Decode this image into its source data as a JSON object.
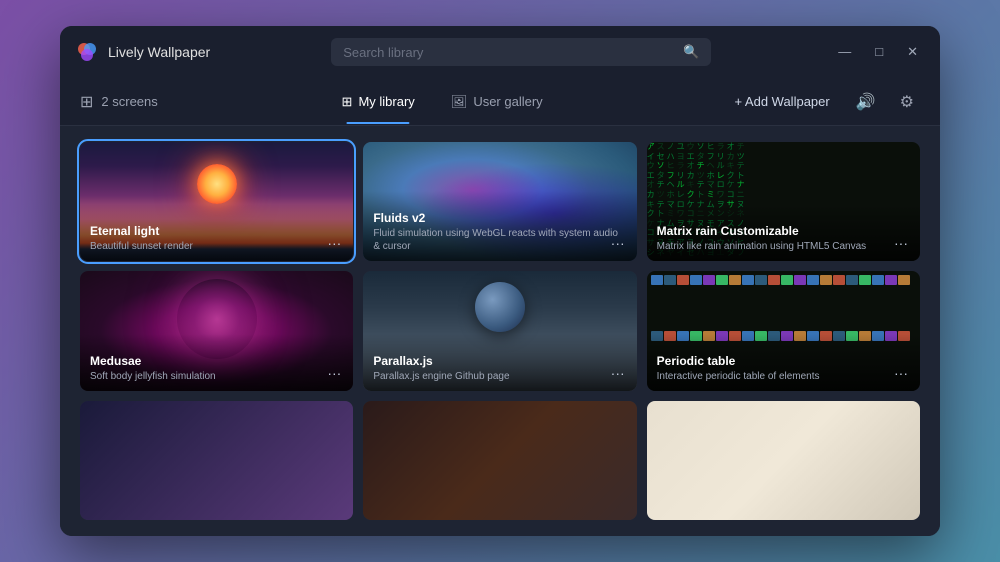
{
  "app": {
    "title": "Lively Wallpaper",
    "search_placeholder": "Search library"
  },
  "window_controls": {
    "minimize": "—",
    "maximize": "□",
    "close": "✕"
  },
  "toolbar": {
    "screens_count": "2 screens",
    "my_library_label": "My library",
    "user_gallery_label": "User gallery",
    "add_wallpaper_label": "+ Add Wallpaper"
  },
  "wallpapers": [
    {
      "id": "eternal-light",
      "title": "Eternal light",
      "desc": "Beautiful sunset render",
      "selected": true
    },
    {
      "id": "fluids-v2",
      "title": "Fluids v2",
      "desc": "Fluid simulation using WebGL reacts with system audio & cursor",
      "selected": false
    },
    {
      "id": "matrix-rain",
      "title": "Matrix rain Customizable",
      "desc": "Matrix like rain animation using HTML5 Canvas",
      "selected": false
    },
    {
      "id": "medusae",
      "title": "Medusae",
      "desc": "Soft body jellyfish simulation",
      "selected": false
    },
    {
      "id": "parallax-js",
      "title": "Parallax.js",
      "desc": "Parallax.js engine Github page",
      "selected": false
    },
    {
      "id": "periodic-table",
      "title": "Periodic table",
      "desc": "Interactive periodic table of elements",
      "selected": false
    },
    {
      "id": "row3-left",
      "title": "",
      "desc": "",
      "selected": false
    },
    {
      "id": "row3-mid",
      "title": "",
      "desc": "",
      "selected": false
    },
    {
      "id": "row3-right",
      "title": "",
      "desc": "",
      "selected": false
    }
  ]
}
